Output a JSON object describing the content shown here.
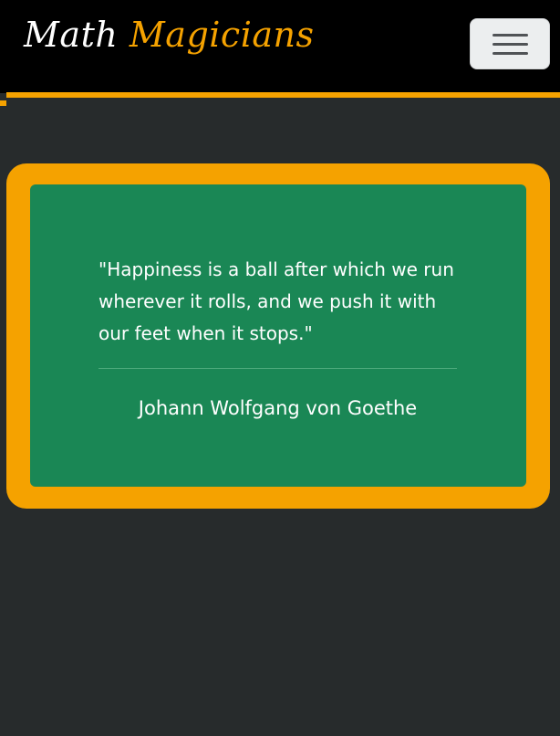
{
  "navbar": {
    "brand_part1": "Math",
    "brand_part2": " Magicians",
    "menu_toggle_icon": "hamburger-menu-icon"
  },
  "quote": {
    "text": "\"Happiness is a ball after which we run wherever it rolls, and we push it with our feet when it stops.\"",
    "author": "Johann Wolfgang von Goethe"
  },
  "colors": {
    "page_background": "#272b2c",
    "navbar_background": "#000000",
    "accent_orange": "#f5a200",
    "card_green": "#1a8755",
    "toggler_background": "#eceeef",
    "text_white": "#ffffff"
  }
}
